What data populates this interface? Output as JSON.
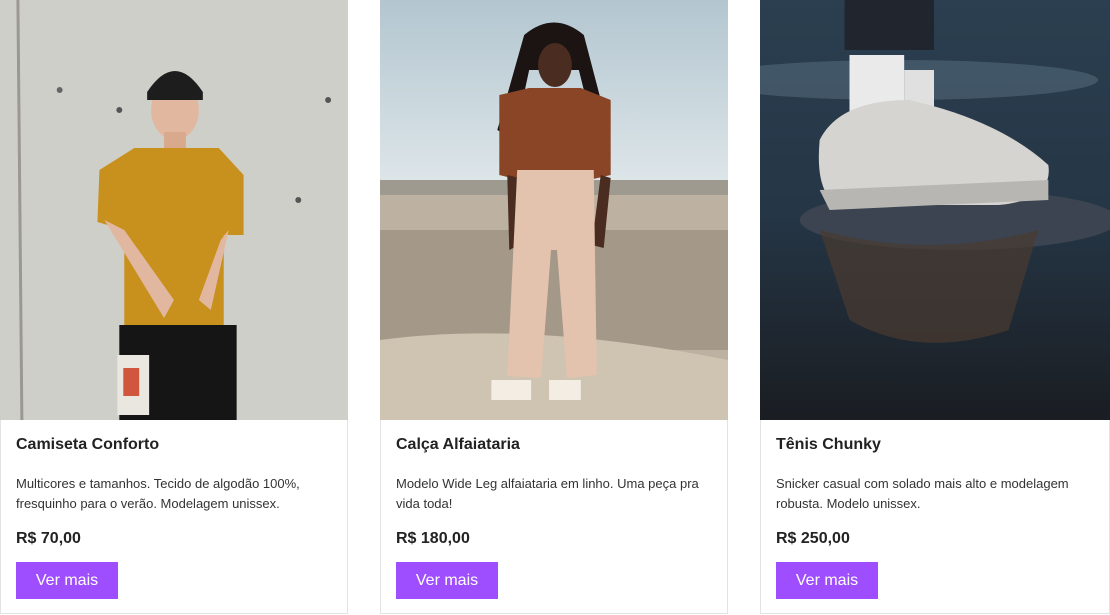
{
  "products": [
    {
      "image_alt": "man in mustard t-shirt and black beanie against concrete wall",
      "title": "Camiseta Conforto",
      "description": "Multicores e tamanhos. Tecido de algodão 100%, fresquinho para o verão. Modelagem unissex.",
      "price": "R$ 70,00",
      "button_label": "Ver mais"
    },
    {
      "image_alt": "woman in brown print shirt and beige wide-leg trousers in a field",
      "title": "Calça Alfaiataria",
      "description": "Modelo Wide Leg alfaiataria em linho. Uma peça pra vida toda!",
      "price": "R$ 180,00",
      "button_label": "Ver mais"
    },
    {
      "image_alt": "chunky white sneakers stepping in a puddle",
      "title": "Tênis Chunky",
      "description": "Snicker casual com solado mais alto e modelagem robusta. Modelo unissex.",
      "price": "R$ 250,00",
      "button_label": "Ver mais"
    }
  ],
  "colors": {
    "accent": "#9e4dff",
    "text": "#222222",
    "border": "#e3e3e3"
  }
}
